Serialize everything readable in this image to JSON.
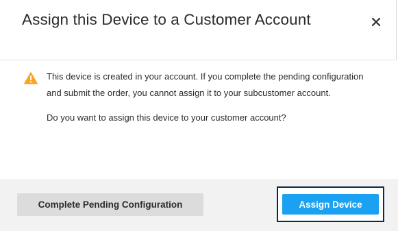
{
  "dialog": {
    "title": "Assign this Device to a Customer Account",
    "close_icon": "close-icon"
  },
  "message": {
    "icon": "warning-icon",
    "icon_color": "#f5a623",
    "paragraph1": "This device is created in your account. If you complete the pending configuration and submit the order, you cannot assign it to your subcustomer account.",
    "paragraph2": "Do you want to assign this device to your customer account?"
  },
  "footer": {
    "secondary_label": "Complete Pending Configuration",
    "primary_label": "Assign Device",
    "primary_color": "#1ba1f2"
  }
}
